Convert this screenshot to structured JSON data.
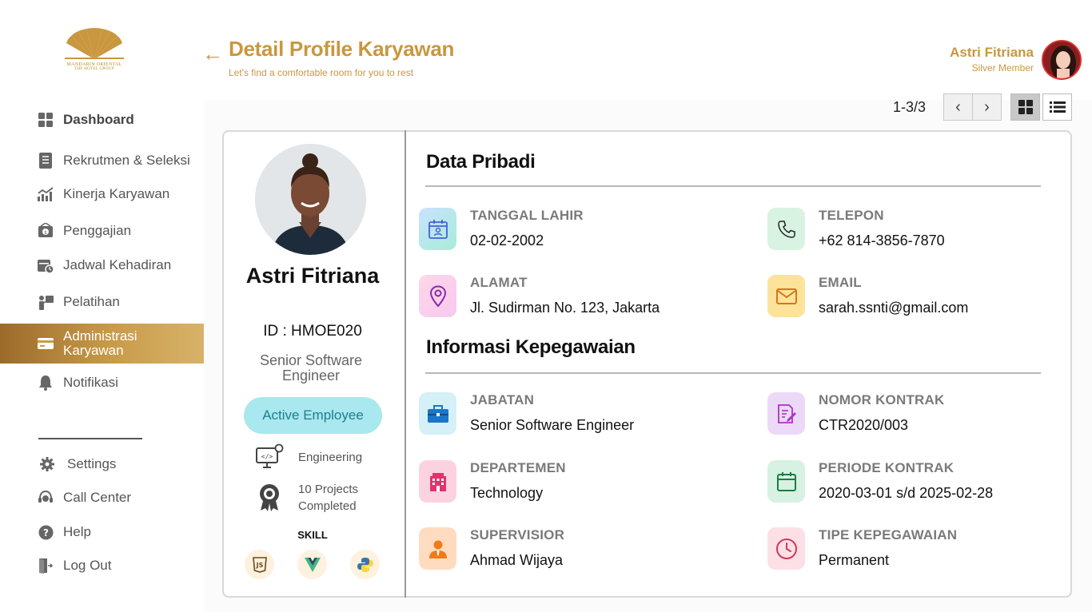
{
  "brand": {
    "line1": "MANDARIN ORIENTAL",
    "line2": "THE HOTEL GROUP"
  },
  "sidebar": {
    "items": [
      {
        "label": "Dashboard"
      },
      {
        "label": "Rekrutmen & Seleksi"
      },
      {
        "label": "Kinerja Karyawan"
      },
      {
        "label": "Penggajian"
      },
      {
        "label": "Jadwal Kehadiran"
      },
      {
        "label": "Pelatihan"
      },
      {
        "label": "Administrasi Karyawan"
      },
      {
        "label": "Notifikasi"
      }
    ],
    "bottom": [
      {
        "label": "Settings"
      },
      {
        "label": "Call Center"
      },
      {
        "label": "Help"
      },
      {
        "label": "Log Out"
      }
    ]
  },
  "header": {
    "title": "Detail Profile Karyawan",
    "subtitle": "Let's find a comfortable room for you to rest",
    "user_name": "Astri Fitriana",
    "user_tier": "Silver Member"
  },
  "pager": {
    "range": "1-3/3"
  },
  "profile": {
    "name": "Astri Fitriana",
    "id": "ID : HMOE020",
    "role": "Senior Software Engineer",
    "status": "Active Employee",
    "department": "Engineering",
    "projects": "10 Projects Completed",
    "skill_label": "SKILL",
    "skills": [
      "javascript-icon",
      "vue-icon",
      "python-icon"
    ]
  },
  "personal": {
    "title": "Data Pribadi",
    "birth_label": "TANGGAL LAHIR",
    "birth_value": "02-02-2002",
    "phone_label": "TELEPON",
    "phone_value": "+62 814-3856-7870",
    "address_label": "ALAMAT",
    "address_value": "Jl. Sudirman No. 123, Jakarta",
    "email_label": "EMAIL",
    "email_value": "sarah.ssnti@gmail.com"
  },
  "employment": {
    "title": "Informasi Kepegawaian",
    "position_label": "JABATAN",
    "position_value": "Senior Software Engineer",
    "contract_label": "NOMOR KONTRAK",
    "contract_value": "CTR2020/003",
    "dept_label": "DEPARTEMEN",
    "dept_value": "Technology",
    "period_label": "PERIODE KONTRAK",
    "period_value": "2020-03-01 s/d 2025-02-28",
    "supervisor_label": "SUPERVISIOR",
    "supervisor_value": "Ahmad Wijaya",
    "type_label": "TIPE KEPEGAWAIAN",
    "type_value": "Permanent"
  },
  "colors": {
    "accent": "#c9973f",
    "status_bg": "#a8e8ee",
    "status_text": "#1f7e8e"
  }
}
